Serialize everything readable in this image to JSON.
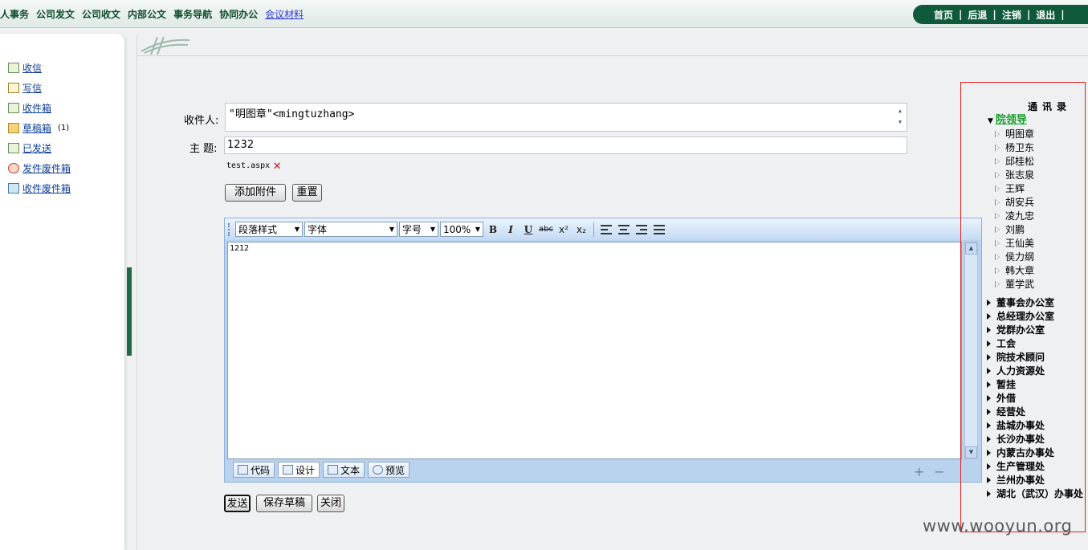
{
  "top_nav": {
    "items": [
      "人事务",
      "公司发文",
      "公司收文",
      "内部公文",
      "事务导航",
      "协同办公"
    ],
    "meeting_link": "会议材料",
    "right_links": [
      "首页",
      "后退",
      "注销",
      "退出"
    ],
    "separator": "|"
  },
  "sidebar": {
    "items": [
      {
        "label": "收信",
        "icon": "inbox-download-icon"
      },
      {
        "label": "写信",
        "icon": "compose-icon"
      },
      {
        "label": "收件箱",
        "icon": "inbox-icon"
      },
      {
        "label": "草稿箱",
        "count": "(1)",
        "icon": "folder-icon"
      },
      {
        "label": "已发送",
        "icon": "sent-icon"
      },
      {
        "label": "发件废件箱",
        "icon": "sent-trash-icon"
      },
      {
        "label": "收件废件箱",
        "icon": "received-trash-icon"
      }
    ]
  },
  "form": {
    "to_label": "收件人:",
    "to_value": "\"明图章\"<mingtuzhang>",
    "subject_label": "主 题:",
    "subject_value": "1232",
    "attachment_name": "test.aspx",
    "add_attachment_button": "添加附件",
    "reset_button": "重置"
  },
  "editor": {
    "paragraph_style": "段落样式",
    "font": "字体",
    "font_size": "字号",
    "zoom": "100%",
    "body_text": "1212",
    "modes": [
      "代码",
      "设计",
      "文本",
      "预览"
    ],
    "active_mode": "设计"
  },
  "actions": {
    "send": "发送",
    "save_draft": "保存草稿",
    "close": "关闭"
  },
  "address_book": {
    "title": "通讯录",
    "open_group": "院领导",
    "members": [
      "明图章",
      "杨卫东",
      "邱桂松",
      "张志泉",
      "王辉",
      "胡安兵",
      "凌九忠",
      "刘鹏",
      "王仙美",
      "侯力纲",
      "韩大章",
      "董学武"
    ],
    "departments": [
      "董事会办公室",
      "总经理办公室",
      "党群办公室",
      "工会",
      "院技术顾问",
      "人力资源处",
      "暂挂",
      "外借",
      "经营处",
      "盐城办事处",
      "长沙办事处",
      "内蒙古办事处",
      "生产管理处",
      "兰州办事处",
      "湖北（武汉）办事处"
    ]
  },
  "watermark": "www.wooyun.org",
  "colors": {
    "brand_green": "#0e5a3a",
    "highlight_red": "#e02020",
    "group_green": "#169d2a"
  }
}
